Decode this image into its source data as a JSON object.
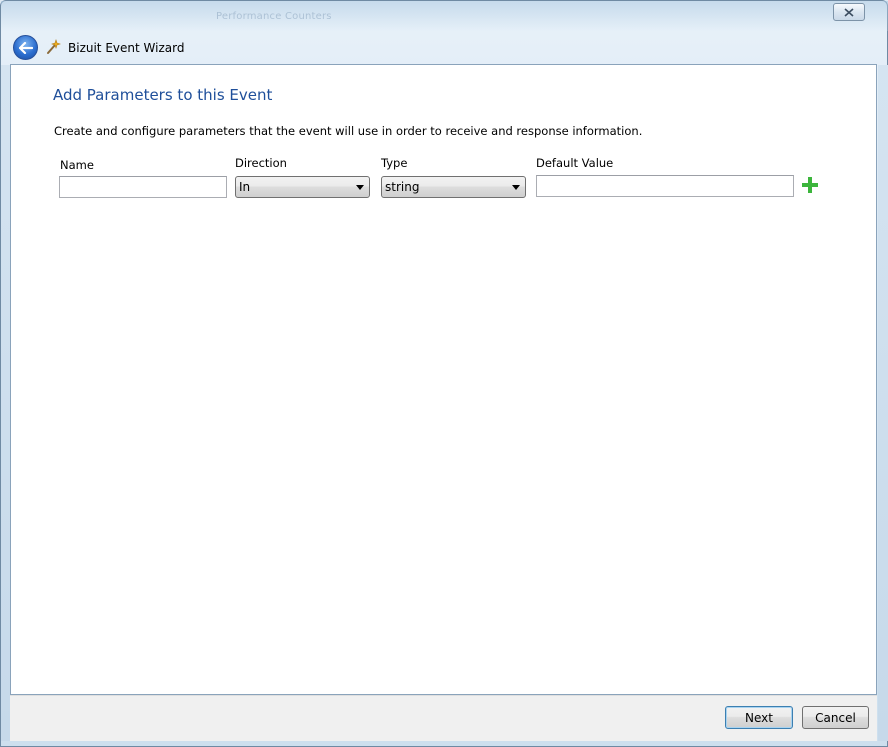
{
  "window": {
    "title": "Bizuit Event Wizard",
    "background_text": "Performance Counters"
  },
  "page": {
    "heading": "Add Parameters to this Event",
    "instruction": "Create and configure parameters that the event will use in order to receive and response information."
  },
  "parameter_form": {
    "name_label": "Name",
    "name_value": "",
    "direction_label": "Direction",
    "direction_value": "In",
    "type_label": "Type",
    "type_value": "string",
    "default_label": "Default Value",
    "default_value": ""
  },
  "footer": {
    "next_label": "Next",
    "cancel_label": "Cancel"
  },
  "colors": {
    "heading": "#1f4f9a",
    "add_icon": "#3cb53c"
  },
  "icons": {
    "back": "back-arrow-icon",
    "app": "wand-icon",
    "add": "plus-icon",
    "close": "close-icon"
  }
}
